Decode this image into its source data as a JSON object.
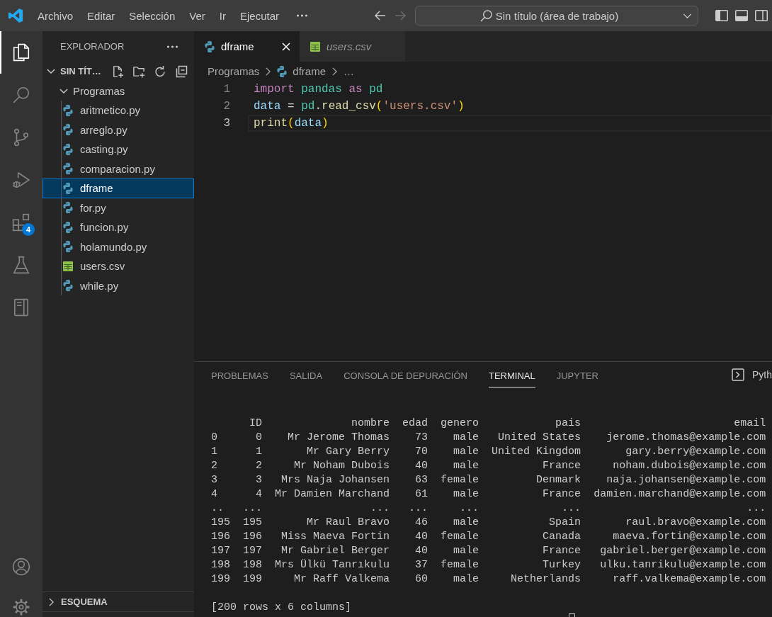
{
  "title_bar": {
    "menu": [
      {
        "label": "Archivo"
      },
      {
        "label": "Editar"
      },
      {
        "label": "Selección"
      },
      {
        "label": "Ver"
      },
      {
        "label": "Ir"
      },
      {
        "label": "Ejecutar"
      }
    ],
    "nav": [
      {
        "kind": "back",
        "disabled": false
      },
      {
        "kind": "forward",
        "disabled": true
      }
    ],
    "command_center": {
      "text": "Sin título (área de trabajo)"
    },
    "layout_toggles": [
      {
        "kind": "sidebar",
        "on": true
      },
      {
        "kind": "panel",
        "on": true
      },
      {
        "kind": "secondary",
        "on": false
      }
    ]
  },
  "activity_bar": {
    "items": [
      {
        "kind": "explorer",
        "selected": true
      },
      {
        "kind": "search",
        "selected": false
      },
      {
        "kind": "source_control",
        "selected": false
      },
      {
        "kind": "run_debug",
        "selected": false
      },
      {
        "kind": "extensions",
        "selected": false,
        "badge": "4"
      },
      {
        "kind": "testing",
        "selected": false
      },
      {
        "kind": "panel",
        "selected": false
      }
    ],
    "bottom": [
      {
        "kind": "account"
      },
      {
        "kind": "settings"
      }
    ]
  },
  "sidebar": {
    "title": "EXPLORADOR",
    "workspace": {
      "label": "SIN TÍT…",
      "expanded": true
    },
    "tree": [
      {
        "label": "Programas",
        "expanded": true,
        "children": [
          {
            "label": "aritmetico.py",
            "kind": "python",
            "selected": false
          },
          {
            "label": "arreglo.py",
            "kind": "python",
            "selected": false
          },
          {
            "label": "casting.py",
            "kind": "python",
            "selected": false
          },
          {
            "label": "comparacion.py",
            "kind": "python",
            "selected": false
          },
          {
            "label": "dframe",
            "kind": "python",
            "selected": true
          },
          {
            "label": "for.py",
            "kind": "python",
            "selected": false
          },
          {
            "label": "funcion.py",
            "kind": "python",
            "selected": false
          },
          {
            "label": "holamundo.py",
            "kind": "python",
            "selected": false
          },
          {
            "label": "users.csv",
            "kind": "csv",
            "selected": false
          },
          {
            "label": "while.py",
            "kind": "python",
            "selected": false
          }
        ]
      }
    ],
    "sections": [
      {
        "label": "ESQUEMA",
        "expanded": false
      }
    ]
  },
  "editor": {
    "tabs": [
      {
        "label": "dframe",
        "kind": "python",
        "selected": true,
        "preview": false
      },
      {
        "label": "users.csv",
        "kind": "csv",
        "selected": false,
        "preview": true
      }
    ],
    "breadcrumb": [
      {
        "label": "Programas"
      },
      {
        "label": "dframe",
        "kind": "python"
      },
      {
        "label": "…"
      }
    ],
    "lines": [
      {
        "number": "1",
        "current": false,
        "tokens": [
          {
            "text": "import",
            "kind": "keyword"
          },
          {
            "text": " pandas",
            "kind": "module"
          },
          {
            "text": " as",
            "kind": "keyword"
          },
          {
            "text": " pd",
            "kind": "module"
          }
        ]
      },
      {
        "number": "2",
        "current": false,
        "tokens": [
          {
            "text": "data",
            "kind": "variable"
          },
          {
            "text": " =",
            "kind": "plain"
          },
          {
            "text": " pd",
            "kind": "module"
          },
          {
            "text": ".",
            "kind": "plain"
          },
          {
            "text": "read_csv",
            "kind": "function"
          },
          {
            "text": "(",
            "kind": "bracket"
          },
          {
            "text": "'users.csv'",
            "kind": "string"
          },
          {
            "text": ")",
            "kind": "bracket"
          }
        ]
      },
      {
        "number": "3",
        "current": true,
        "tokens": [
          {
            "text": "print",
            "kind": "function"
          },
          {
            "text": "(",
            "kind": "bracket"
          },
          {
            "text": "data",
            "kind": "variable"
          },
          {
            "text": ")",
            "kind": "bracket"
          }
        ]
      }
    ]
  },
  "panel": {
    "tabs": [
      {
        "label": "PROBLEMAS",
        "selected": false
      },
      {
        "label": "SALIDA",
        "selected": false
      },
      {
        "label": "CONSOLA DE DEPURACIÓN",
        "selected": false
      },
      {
        "label": "TERMINAL",
        "selected": true
      },
      {
        "label": "JUPYTER",
        "selected": false
      }
    ],
    "terminal_profile": "Pyth",
    "terminal": {
      "columns": [
        "ID",
        "nombre",
        "edad",
        "genero",
        "pais",
        "email"
      ],
      "rows": [
        {
          "index": "0",
          "cells": [
            "0",
            "Mr Jerome Thomas",
            "73",
            "male",
            "United States",
            "jerome.thomas@example.com"
          ]
        },
        {
          "index": "1",
          "cells": [
            "1",
            "Mr Gary Berry",
            "70",
            "male",
            "United Kingdom",
            "gary.berry@example.com"
          ]
        },
        {
          "index": "2",
          "cells": [
            "2",
            "Mr Noham Dubois",
            "40",
            "male",
            "France",
            "noham.dubois@example.com"
          ]
        },
        {
          "index": "3",
          "cells": [
            "3",
            "Mrs Naja Johansen",
            "63",
            "female",
            "Denmark",
            "naja.johansen@example.com"
          ]
        },
        {
          "index": "4",
          "cells": [
            "4",
            "Mr Damien Marchand",
            "61",
            "male",
            "France",
            "damien.marchand@example.com"
          ]
        },
        {
          "index": "..",
          "cells": [
            "...",
            "...",
            "...",
            "...",
            "...",
            "..."
          ]
        },
        {
          "index": "195",
          "cells": [
            "195",
            "Mr Raul Bravo",
            "46",
            "male",
            "Spain",
            "raul.bravo@example.com"
          ]
        },
        {
          "index": "196",
          "cells": [
            "196",
            "Miss Maeva Fortin",
            "40",
            "female",
            "Canada",
            "maeva.fortin@example.com"
          ]
        },
        {
          "index": "197",
          "cells": [
            "197",
            "Mr Gabriel Berger",
            "40",
            "male",
            "France",
            "gabriel.berger@example.com"
          ]
        },
        {
          "index": "198",
          "cells": [
            "198",
            "Mrs Ülkü Tanrıkulu",
            "37",
            "female",
            "Turkey",
            "ulku.tanrikulu@example.com"
          ]
        },
        {
          "index": "199",
          "cells": [
            "199",
            "Mr Raff Valkema",
            "60",
            "male",
            "Netherlands",
            "raff.valkema@example.com"
          ]
        }
      ],
      "summary": "[200 rows x 6 columns]"
    }
  }
}
